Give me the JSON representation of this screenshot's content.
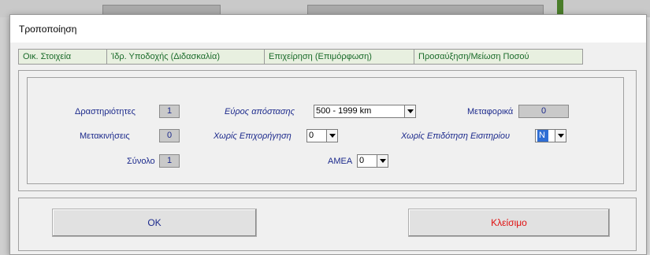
{
  "dialog": {
    "title": "Τροποποίηση"
  },
  "tabs": [
    {
      "label": "Οικ. Στοιχεία"
    },
    {
      "label": "Ίδρ. Υποδοχής (Διδασκαλία)"
    },
    {
      "label": "Επιχείρηση (Επιμόρφωση)"
    },
    {
      "label": "Προσαύξηση/Μείωση Ποσού"
    }
  ],
  "fields": {
    "drastiriotites": {
      "label": "Δραστηριότητες",
      "value": "1"
    },
    "evros": {
      "label": "Εύρος απόστασης",
      "value": "500 - 1999 km"
    },
    "metaforika": {
      "label": "Μεταφορικά",
      "value": "0"
    },
    "metakiniseis": {
      "label": "Μετακινήσεις",
      "value": "0"
    },
    "xwris_epixorigisi": {
      "label": "Χωρίς Επιχορήγηση",
      "value": "0"
    },
    "xwris_epidotisi": {
      "label": "Χωρίς Επιδότηση Εισιτηρίου",
      "value": "N"
    },
    "synolo": {
      "label": "Σύνολο",
      "value": "1"
    },
    "amea": {
      "label": "ΑΜΕΑ",
      "value": "0"
    }
  },
  "buttons": {
    "ok": "OK",
    "close": "Κλείσιμο"
  },
  "colors": {
    "label_blue": "#1c2a8c",
    "tab_green": "#1a6b2a",
    "close_red": "#e01010",
    "selection_blue": "#2f6ed4"
  }
}
